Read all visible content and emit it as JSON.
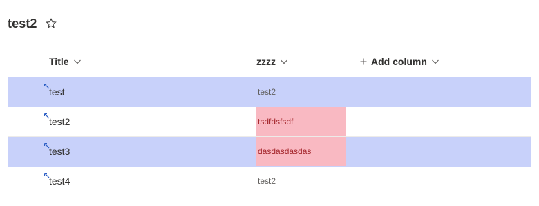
{
  "list": {
    "title": "test2"
  },
  "icons": {
    "favorite": "star-outline-icon",
    "sort": "chevron-down-icon",
    "add": "plus-icon",
    "new_item": "new-item-sparkle-icon"
  },
  "colors": {
    "selected_row": "#c8d1fa",
    "highlight_cell_bg": "#f9b9c2",
    "highlight_cell_text": "#a4262c",
    "new_icon": "#2b5ec4"
  },
  "columns": [
    {
      "label": "Title"
    },
    {
      "label": "zzzz"
    },
    {
      "label": "Add column"
    }
  ],
  "rows": [
    {
      "title": "test",
      "zzzz": "test2",
      "selected": true,
      "highlight": false
    },
    {
      "title": "test2",
      "zzzz": "tsdfdsfsdf",
      "selected": false,
      "highlight": true
    },
    {
      "title": "test3",
      "zzzz": "dasdasdasdas",
      "selected": true,
      "highlight": true
    },
    {
      "title": "test4",
      "zzzz": "test2",
      "selected": false,
      "highlight": false
    }
  ]
}
